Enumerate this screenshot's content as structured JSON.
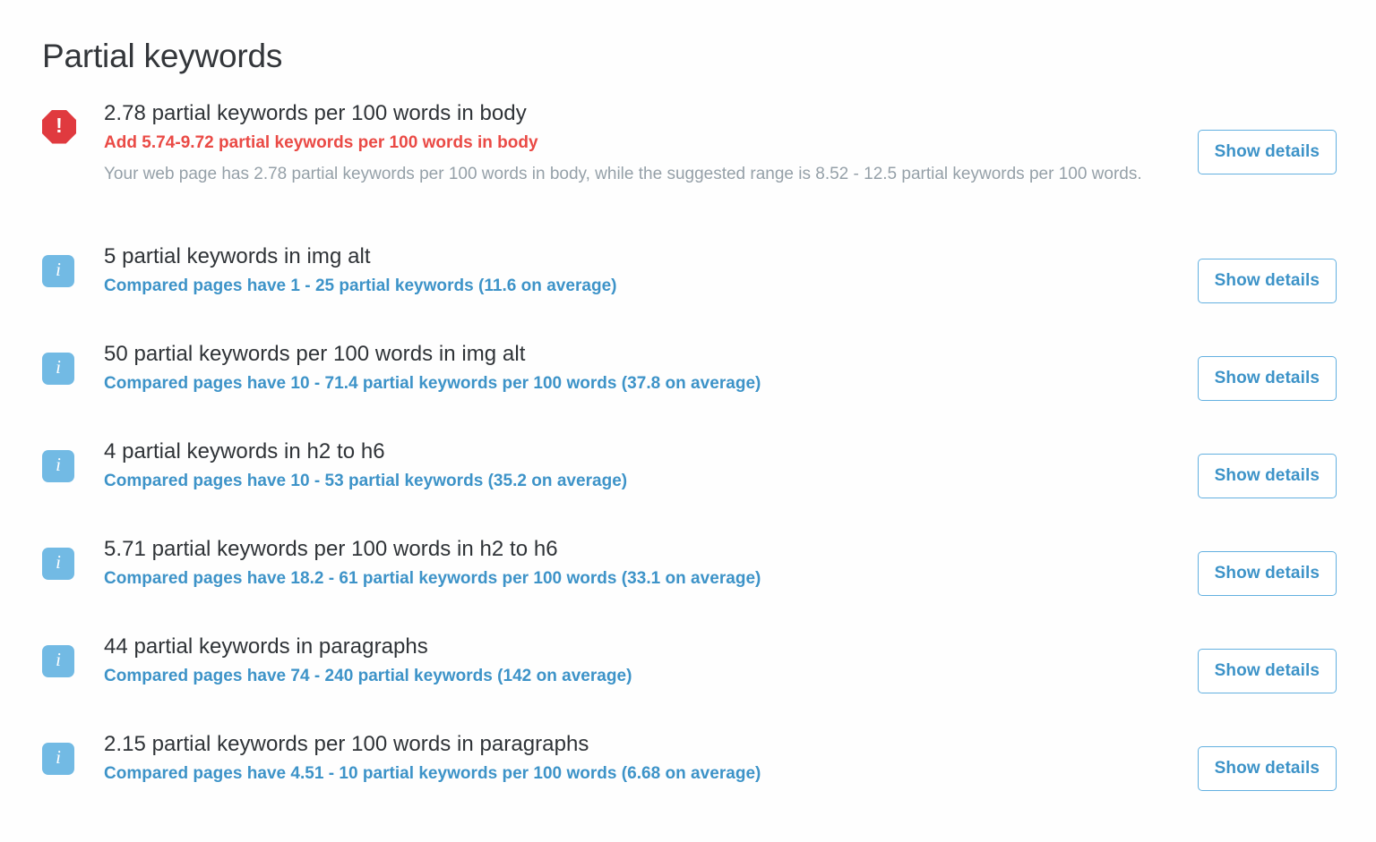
{
  "page": {
    "title": "Partial keywords",
    "background_color": "#fefefe"
  },
  "colors": {
    "alert_red": "#ea4a45",
    "link_blue": "#3d93c8",
    "info_icon_blue": "#72bae4",
    "button_border_blue": "#63b0e0",
    "headline_text": "#2f3337",
    "muted_text": "#95a0a8"
  },
  "button": {
    "show_details_label": "Show details"
  },
  "icons": {
    "alert": "alert-octagon-icon",
    "info": "info-icon",
    "alert_glyph": "!",
    "info_glyph": "i"
  },
  "items": [
    {
      "status": "alert",
      "headline": "2.78 partial keywords per 100 words in body",
      "sub": "Add 5.74-9.72 partial keywords per 100 words in body",
      "description": "Your web page has 2.78 partial keywords per 100 words in body, while the suggested range is 8.52 - 12.5 partial keywords per 100 words.",
      "action": "Show details"
    },
    {
      "status": "info",
      "headline": "5 partial keywords in img alt",
      "sub": "Compared pages have 1 - 25 partial keywords (11.6 on average)",
      "description": "",
      "action": "Show details"
    },
    {
      "status": "info",
      "headline": "50 partial keywords per 100 words in img alt",
      "sub": "Compared pages have 10 - 71.4 partial keywords per 100 words (37.8 on average)",
      "description": "",
      "action": "Show details"
    },
    {
      "status": "info",
      "headline": "4 partial keywords in h2 to h6",
      "sub": "Compared pages have 10 - 53 partial keywords (35.2 on average)",
      "description": "",
      "action": "Show details"
    },
    {
      "status": "info",
      "headline": "5.71 partial keywords per 100 words in h2 to h6",
      "sub": "Compared pages have 18.2 - 61 partial keywords per 100 words (33.1 on average)",
      "description": "",
      "action": "Show details"
    },
    {
      "status": "info",
      "headline": "44 partial keywords in paragraphs",
      "sub": "Compared pages have 74 - 240 partial keywords (142 on average)",
      "description": "",
      "action": "Show details"
    },
    {
      "status": "info",
      "headline": "2.15 partial keywords per 100 words in paragraphs",
      "sub": "Compared pages have 4.51 - 10 partial keywords per 100 words (6.68 on average)",
      "description": "",
      "action": "Show details"
    }
  ]
}
